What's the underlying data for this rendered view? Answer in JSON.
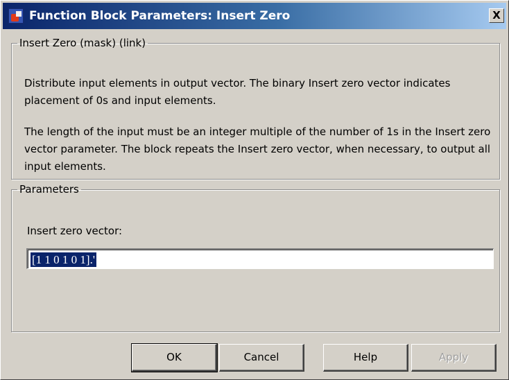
{
  "window": {
    "title": "Function Block Parameters: Insert Zero",
    "close_label": "X"
  },
  "mask_group": {
    "legend": "Insert Zero (mask) (link)",
    "description_1": "Distribute input elements in output vector. The binary Insert zero vector indicates placement of 0s and input elements.",
    "description_2": "The length of the input must be an integer multiple of the number of 1s in the Insert zero vector parameter. The block repeats the Insert zero vector, when necessary, to output all input elements."
  },
  "parameters": {
    "legend": "Parameters",
    "field_label": "Insert zero vector:",
    "field_value": "[1 1 0 1 0 1].'"
  },
  "buttons": {
    "ok": "OK",
    "cancel": "Cancel",
    "help": "Help",
    "apply": "Apply"
  },
  "icons": {
    "app": "simulink-block-icon",
    "close": "close-icon"
  },
  "colors": {
    "title_bar": "#0a246a",
    "selection": "#0a246a",
    "dialog_bg": "#d4d0c8"
  }
}
